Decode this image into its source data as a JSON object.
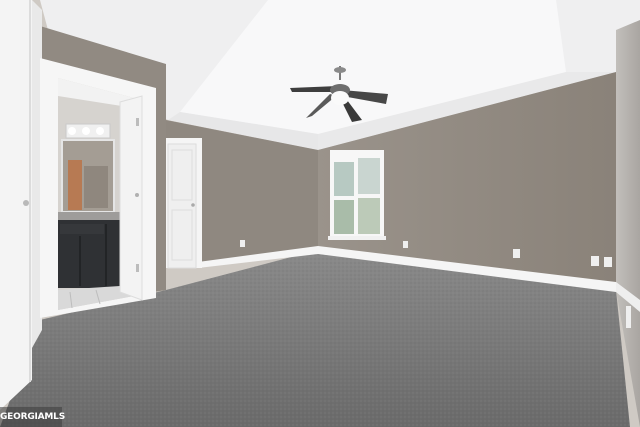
{
  "watermark": {
    "text": "GEORGIAMLS"
  },
  "colors": {
    "ceiling": "#f1f1f2",
    "tray_ceiling": "#f7f7f8",
    "wall_back": "#928a81",
    "wall_left_back": "#8f8880",
    "wall_left_front": "#918a82",
    "wall_right": "#b9b5b1",
    "carpet": "#777777",
    "trim": "#f7f7f7",
    "vanity": "#2f3134",
    "window_glass": "#b8c7c9"
  }
}
